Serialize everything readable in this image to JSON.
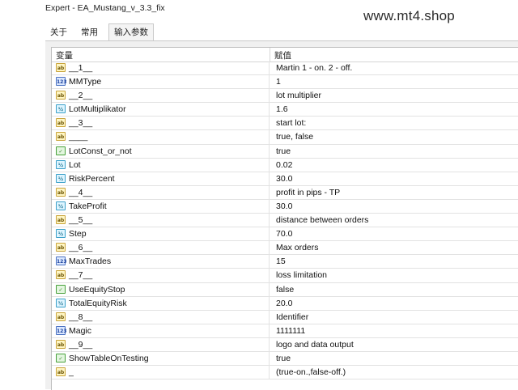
{
  "window": {
    "title": "Expert - EA_Mustang_v_3.3_fix"
  },
  "watermark": "www.mt4.shop",
  "tabs": [
    {
      "label": "关于",
      "active": false
    },
    {
      "label": "常用",
      "active": false
    },
    {
      "label": "输入参数",
      "active": true
    }
  ],
  "table": {
    "columns": [
      "变量",
      "赋值"
    ],
    "rows": [
      {
        "type": "ab",
        "name": "__1__",
        "value": "Martin 1 - on. 2 - off."
      },
      {
        "type": "int",
        "name": "MMType",
        "value": "1"
      },
      {
        "type": "ab",
        "name": "__2__",
        "value": "lot multiplier"
      },
      {
        "type": "dbl",
        "name": "LotMultiplikator",
        "value": "1.6"
      },
      {
        "type": "ab",
        "name": "__3__",
        "value": "start lot:"
      },
      {
        "type": "ab",
        "name": "____",
        "value": "true, false"
      },
      {
        "type": "bool",
        "name": "LotConst_or_not",
        "value": "true"
      },
      {
        "type": "dbl",
        "name": "Lot",
        "value": "0.02"
      },
      {
        "type": "dbl",
        "name": "RiskPercent",
        "value": "30.0"
      },
      {
        "type": "ab",
        "name": "__4__",
        "value": "profit in pips - TP"
      },
      {
        "type": "dbl",
        "name": "TakeProfit",
        "value": "30.0"
      },
      {
        "type": "ab",
        "name": "__5__",
        "value": "distance between orders"
      },
      {
        "type": "dbl",
        "name": "Step",
        "value": "70.0"
      },
      {
        "type": "ab",
        "name": "__6__",
        "value": "Max orders"
      },
      {
        "type": "int",
        "name": "MaxTrades",
        "value": "15"
      },
      {
        "type": "ab",
        "name": "__7__",
        "value": "loss limitation"
      },
      {
        "type": "bool",
        "name": "UseEquityStop",
        "value": "false"
      },
      {
        "type": "dbl",
        "name": "TotalEquityRisk",
        "value": "20.0"
      },
      {
        "type": "ab",
        "name": "__8__",
        "value": "Identifier"
      },
      {
        "type": "int",
        "name": "Magic",
        "value": "1111111"
      },
      {
        "type": "ab",
        "name": "__9__",
        "value": "logo and data output"
      },
      {
        "type": "bool",
        "name": "ShowTableOnTesting",
        "value": "true"
      },
      {
        "type": "ab",
        "name": "_",
        "value": "(true-on.,false-off.)"
      }
    ]
  },
  "icon_names": {
    "ab": "string-param-icon",
    "int": "integer-param-icon",
    "dbl": "double-param-icon",
    "bool": "boolean-param-icon"
  },
  "icon_glyphs": {
    "ab": "ab",
    "int": "123",
    "dbl": "½",
    "bool": "✓"
  }
}
